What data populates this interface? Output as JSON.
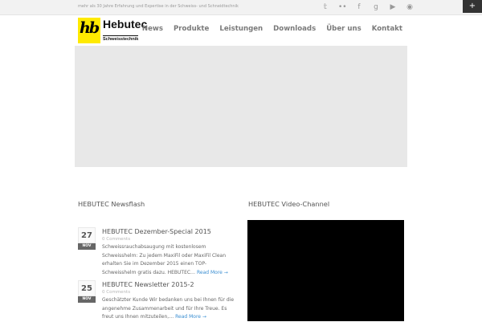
{
  "topbar": {
    "tagline": "mehr als 30 Jahre Erfahrung und Expertise in der Schweiss- und Schneidtechnik",
    "social": [
      {
        "icon": "twitter-icon",
        "glyph": "𝕥"
      },
      {
        "icon": "flickr-icon",
        "glyph": "••"
      },
      {
        "icon": "facebook-icon",
        "glyph": "f"
      },
      {
        "icon": "google-plus-icon",
        "glyph": "g"
      },
      {
        "icon": "youtube-icon",
        "glyph": "▶"
      },
      {
        "icon": "rss-icon",
        "glyph": "◉"
      }
    ],
    "corner_glyph": "+"
  },
  "logo": {
    "mark": "hb",
    "name": "Hebutec",
    "subtitle": "Schweisstechnik",
    "mark_color": "#ffea00"
  },
  "nav": {
    "items": [
      "News",
      "Produkte",
      "Leistungen",
      "Downloads",
      "Über uns",
      "Kontakt"
    ]
  },
  "newsflash": {
    "title": "HEBUTEC Newsflash",
    "posts": [
      {
        "day": "27",
        "month": "NOV",
        "title": "HEBUTEC Dezember-Special 2015",
        "meta": "0 Comments",
        "text": "Schweissrauchabsaugung mit kostenlosem Schweisshelm: Zu jedem MaxiFil oder MaxiFil Clean erhalten Sie im Dezember 2015 einen TOP-Schweisshelm gratis dazu. HEBUTEC…",
        "read_more": "Read More →"
      },
      {
        "day": "25",
        "month": "NOV",
        "title": "HEBUTEC Newsletter 2015-2",
        "meta": "0 Comments",
        "text": "Geschätzter Kunde Wir bedanken uns bei Ihnen für die angenehme Zusammenarbeit und für Ihre Treue. Es freut uns Ihnen mitzuteilen,…",
        "read_more": "Read More →"
      }
    ]
  },
  "video_channel": {
    "title": "HEBUTEC Video-Channel"
  },
  "colors": {
    "accent_link": "#3a8ed1",
    "nav_text": "#7a7a7a",
    "slider_bg": "#e8e8e8"
  }
}
